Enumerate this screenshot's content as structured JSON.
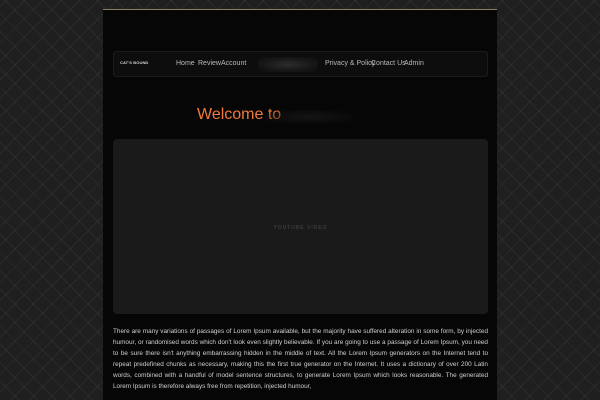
{
  "navbar": {
    "brand": "CAT'S BOUND",
    "links_left": [
      "Home",
      "Review",
      "Account"
    ],
    "links_right": [
      "Privacy & Policy",
      "Contact Us",
      "Admin"
    ]
  },
  "hero": {
    "welcome": "Welcome to"
  },
  "video": {
    "label": "YOUTUBE VIDEO"
  },
  "content": {
    "paragraph": "There are many variations of passages of Lorem Ipsum available, but the majority have suffered alteration in some form, by injected humour, or randomised words which don't look even slightly believable. If you are going to use a passage of Lorem Ipsum, you need to be sure there isn't anything embarrassing hidden in the middle of text. All the Lorem Ipsum generators on the Internet tend to repeat predefined chunks as necessary, making this the first true generator on the Internet. It uses a dictionary of over 200 Latin words, combined with a handful of model sentence structures, to generate Lorem Ipsum which looks reasonable. The generated Lorem Ipsum is therefore always free from repetition, injected humour,"
  },
  "colors": {
    "accent": "#f07a3c",
    "background": "#060606",
    "frame_border": "#8a7d60"
  }
}
